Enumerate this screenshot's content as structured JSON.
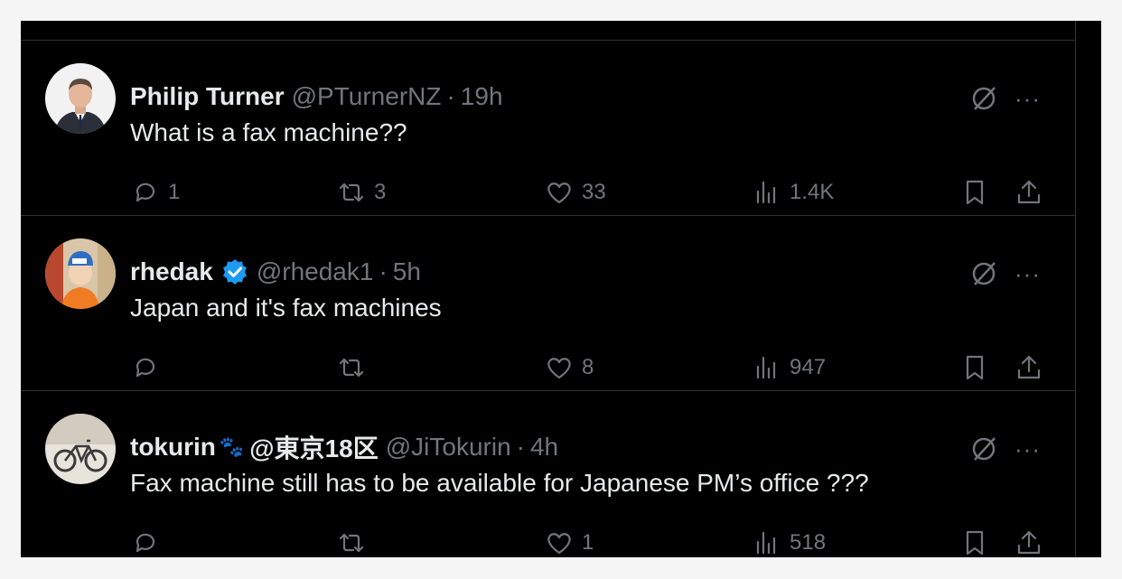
{
  "posts": [
    {
      "name": "Philip Turner",
      "handle": "@PTurnerNZ",
      "time": "19h",
      "verified": false,
      "text": "What is a fax machine??",
      "replies": "1",
      "reposts": "3",
      "likes": "33",
      "views": "1.4K",
      "avatar": "avatar-man-suit"
    },
    {
      "name": "rhedak",
      "handle": "@rhedak1",
      "time": "5h",
      "verified": true,
      "text": "Japan and it's fax machines",
      "replies": "",
      "reposts": "",
      "likes": "8",
      "views": "947",
      "avatar": "avatar-cartoon-orange"
    },
    {
      "name": "tokurin",
      "name_emoji": "🐾",
      "name_suffix": "@東京18区",
      "handle": "@JiTokurin",
      "time": "4h",
      "verified": false,
      "text": "Fax machine still has to be available for Japanese PM’s office ???",
      "replies": "",
      "reposts": "",
      "likes": "1",
      "views": "518",
      "avatar": "avatar-bicycle-photo"
    }
  ],
  "separator": "·",
  "more_label": "···",
  "colors": {
    "background": "#000000",
    "text_primary": "#e7e9ea",
    "text_secondary": "#71767b",
    "divider": "#2f3336",
    "verified": "#1d9bf0"
  },
  "icons": [
    "grok-icon",
    "more-icon",
    "reply-icon",
    "repost-icon",
    "like-icon",
    "views-icon",
    "bookmark-icon",
    "share-icon",
    "verified-badge-icon"
  ]
}
